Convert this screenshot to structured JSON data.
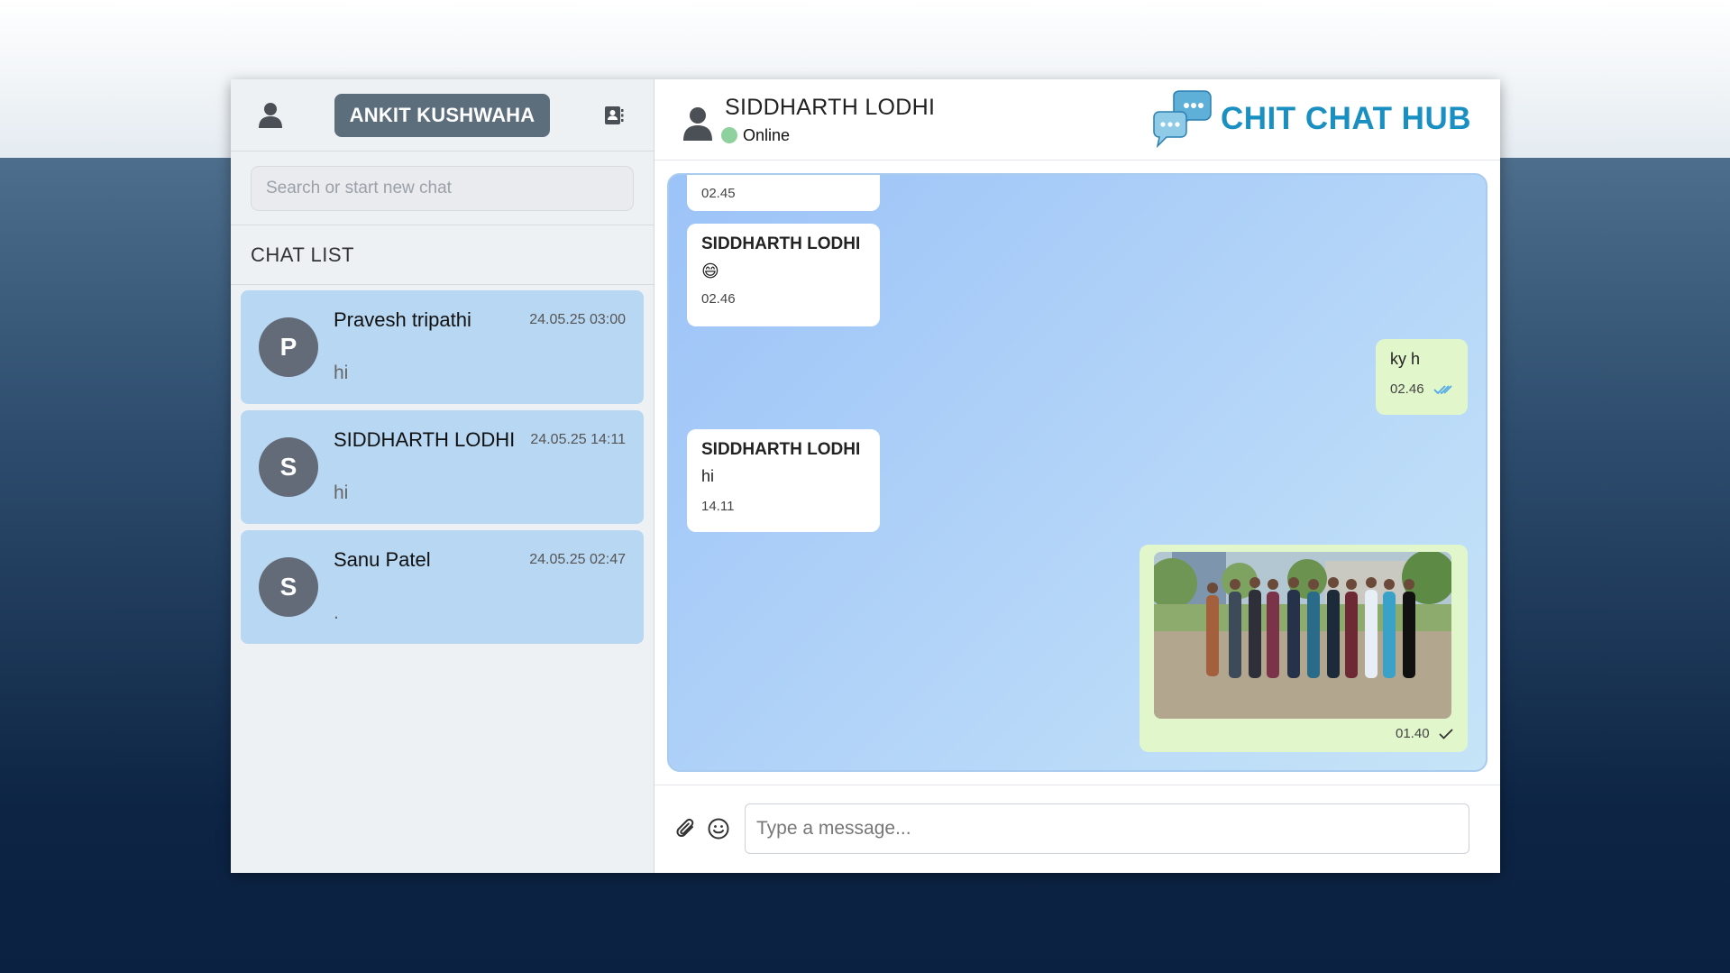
{
  "sidebar": {
    "user_name": "ANKIT KUSHWAHA",
    "search_placeholder": "Search or start new chat",
    "chat_list_title": "CHAT LIST",
    "chats": [
      {
        "initial": "P",
        "name": "Pravesh tripathi",
        "time": "24.05.25 03:00",
        "preview": "hi"
      },
      {
        "initial": "S",
        "name": "SIDDHARTH LODHI",
        "time": "24.05.25 14:11",
        "preview": "hi"
      },
      {
        "initial": "S",
        "name": "Sanu Patel",
        "time": "24.05.25 02:47",
        "preview": "."
      }
    ]
  },
  "header": {
    "contact_name": "SIDDHARTH LODHI",
    "status": "Online",
    "brand": "CHIT CHAT HUB"
  },
  "messages": [
    {
      "direction": "in",
      "time": "02.45"
    },
    {
      "direction": "in",
      "sender": "SIDDHARTH LODHI",
      "text": "😄",
      "time": "02.46"
    },
    {
      "direction": "out",
      "text": "ky h",
      "time": "02.46",
      "status": "read"
    },
    {
      "direction": "in",
      "sender": "SIDDHARTH LODHI",
      "text": "hi",
      "time": "14.11"
    },
    {
      "direction": "out",
      "type": "image",
      "time": "01.40",
      "status": "sent"
    }
  ],
  "composer": {
    "placeholder": "Type a message..."
  },
  "colors": {
    "accent": "#1a8fc2",
    "chat_item_bg": "#b8d7f2",
    "outgoing_bubble": "#e1f6cb",
    "online_dot": "#8fd19e",
    "read_tick": "#4fa9e8"
  }
}
